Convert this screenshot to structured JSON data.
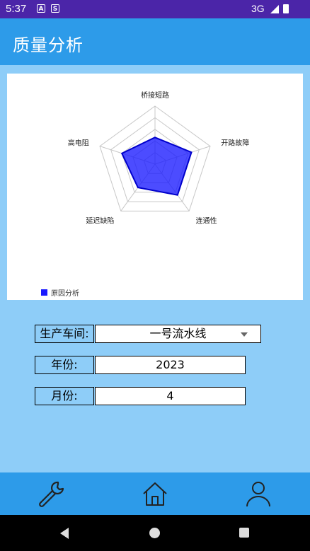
{
  "status_bar": {
    "time": "5:37",
    "icon_a": "A",
    "icon_s": "S",
    "network": "3G"
  },
  "app_bar": {
    "title": "质量分析"
  },
  "chart_data": {
    "type": "radar",
    "axes": [
      "桥接短路",
      "开路故障",
      "连通性",
      "延迟缺陷",
      "高电阻"
    ],
    "series": [
      {
        "name": "原因分析",
        "values": [
          2.3,
          3.3,
          3.3,
          2.5,
          3.0
        ]
      }
    ],
    "max": 5,
    "rings": 5,
    "series_color": "#1a1aff",
    "legend_position": "bottom-left"
  },
  "form": {
    "workshop_label": "生产车间:",
    "workshop_value": "一号流水线",
    "year_label": "年份:",
    "year_value": "2023",
    "month_label": "月份:",
    "month_value": "4"
  },
  "bottom_nav": {
    "items": [
      "wrench-icon",
      "home-icon",
      "user-icon"
    ]
  },
  "colors": {
    "status_bar": "#4b25a8",
    "app_bar": "#2d9be9",
    "background": "#8ecdf8"
  }
}
